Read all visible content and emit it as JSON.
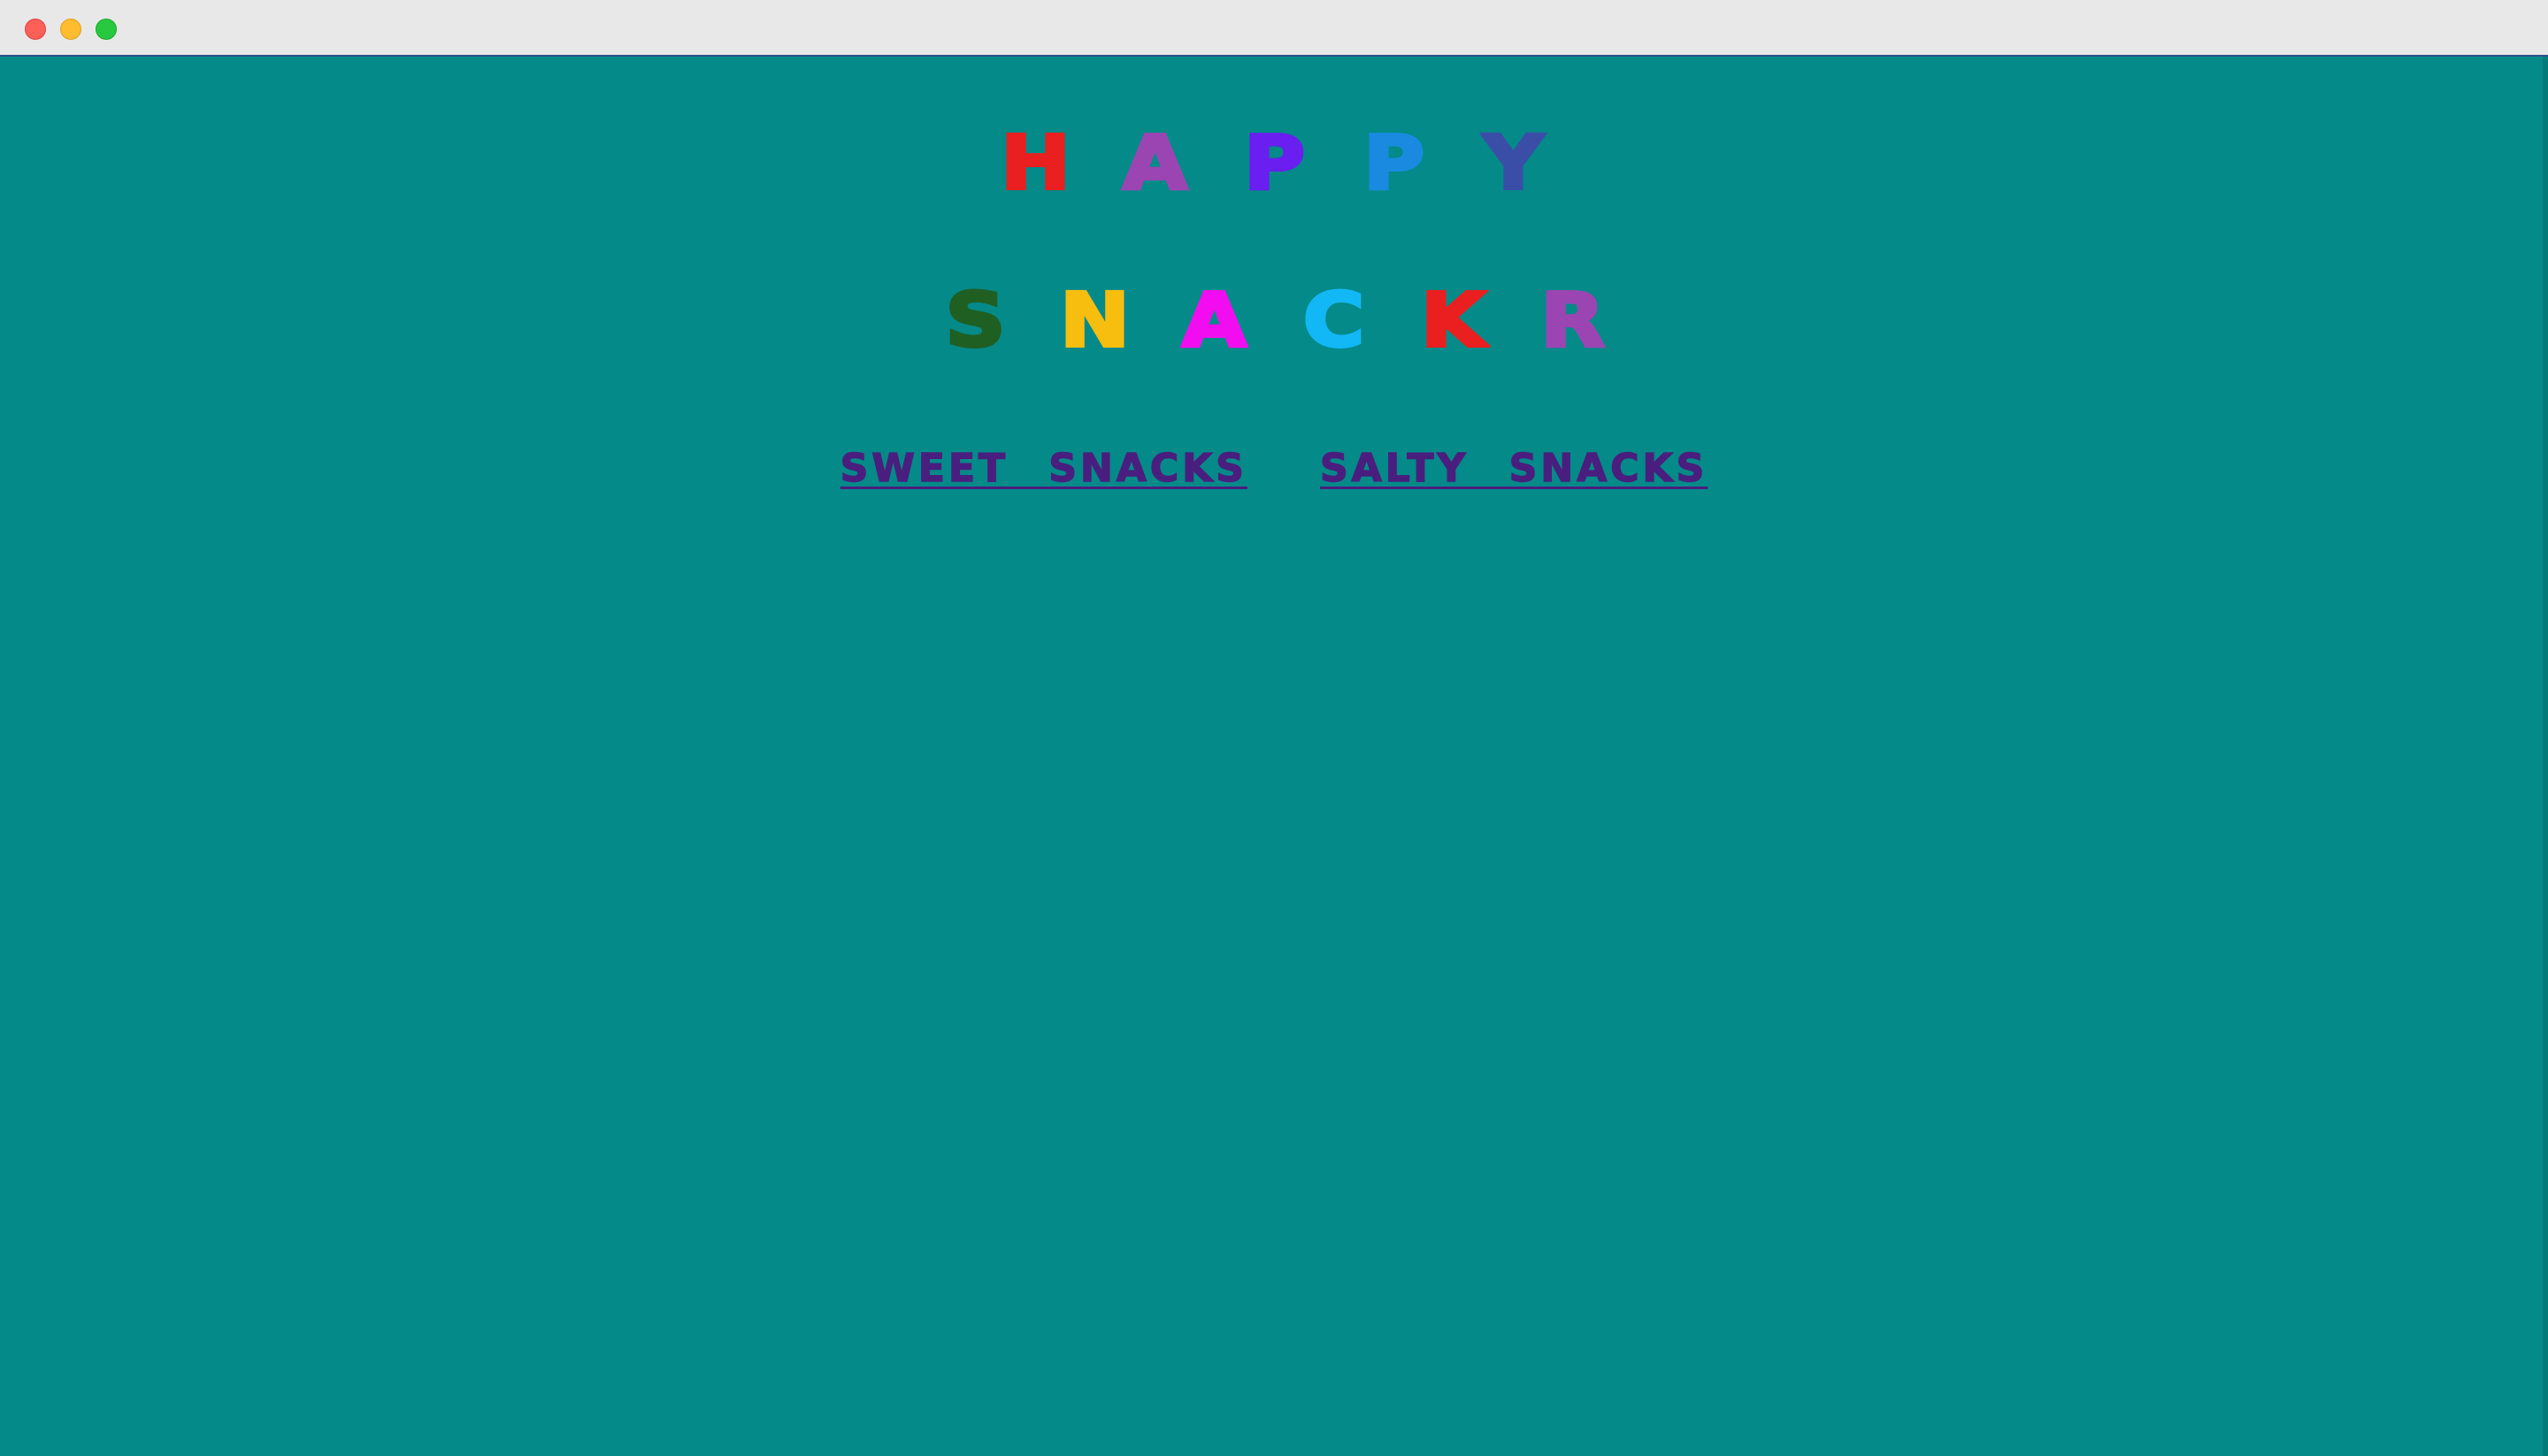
{
  "window": {
    "controls": [
      "close-button",
      "minimize-button",
      "maximize-button"
    ]
  },
  "title_word_1": [
    {
      "char": "H",
      "color": "#ea1f20"
    },
    {
      "char": "A",
      "color": "#9b45b3"
    },
    {
      "char": "P",
      "color": "#6a1ef0"
    },
    {
      "char": "P",
      "color": "#1a8ae0"
    },
    {
      "char": "Y",
      "color": "#3a4ea8"
    }
  ],
  "title_word_2": [
    {
      "char": "S",
      "color": "#205f22"
    },
    {
      "char": "N",
      "color": "#f7be0f"
    },
    {
      "char": "A",
      "color": "#f20df0"
    },
    {
      "char": "C",
      "color": "#12b8f5"
    },
    {
      "char": "K",
      "color": "#ea1f20"
    },
    {
      "char": "R",
      "color": "#9b45b3"
    }
  ],
  "nav": {
    "sweet_label": "SWEET SNACKS",
    "salty_label": "SALTY SNACKS"
  },
  "colors": {
    "background": "#038a89",
    "link": "#4a1e7e"
  }
}
